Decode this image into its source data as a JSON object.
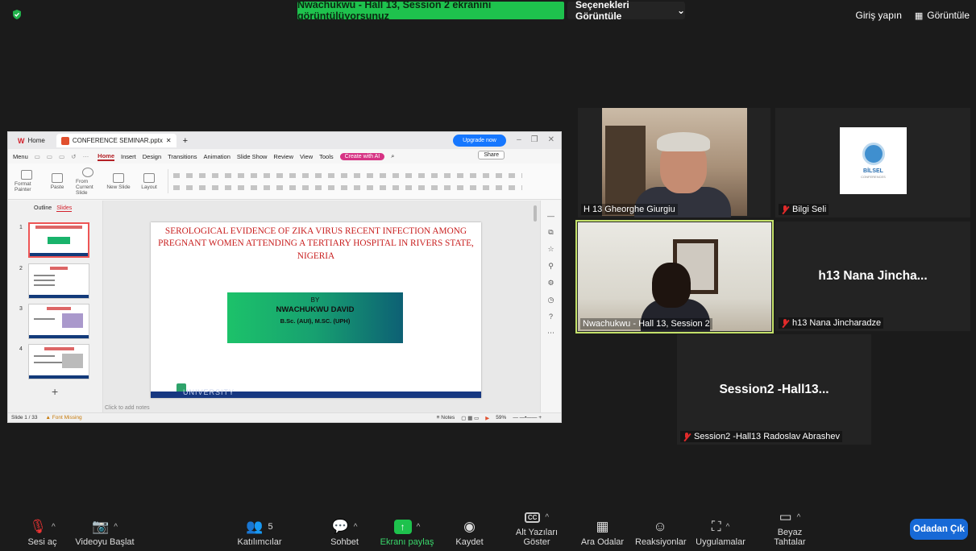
{
  "top": {
    "banner": "Nwachukwu - Hall 13, Session 2 ekranını görüntülüyorsunuz",
    "view_options": "Seçenekleri Görüntüle",
    "sign_in": "Giriş yapın",
    "view": "Görüntüle"
  },
  "shared_app": {
    "tab_home": "Home",
    "tab_file": "CONFERENCE SEMINAR.pptx",
    "upgrade": "Upgrade now",
    "menu": [
      "Menu",
      "Home",
      "Insert",
      "Design",
      "Transitions",
      "Animation",
      "Slide Show",
      "Review",
      "View",
      "Tools"
    ],
    "ai_button": "Create with AI",
    "share_button": "Share",
    "ribbon": [
      "Format Painter",
      "Paste",
      "From Current Slide",
      "New Slide",
      "Layout"
    ],
    "side_tabs": [
      "Outline",
      "Slides"
    ],
    "thumb_numbers": [
      "1",
      "2",
      "3",
      "4"
    ],
    "slide_title": "SEROLOGICAL EVIDENCE OF ZIKA VIRUS RECENT INFECTION AMONG PREGNANT WOMEN ATTENDING A TERTIARY HOSPITAL IN RIVERS STATE, NIGERIA",
    "slide_by": "BY",
    "slide_name": "NWACHUKWU DAVID",
    "slide_degree": "B.Sc. (AUI), M.SC. (UPH)",
    "slide_footer": "UNIVERSITY",
    "notes": "Click to add notes",
    "status_slide": "Slide 1 / 33",
    "status_font": "Font Missing",
    "status_notes": "Notes",
    "zoom": "59%"
  },
  "participants": {
    "p1": "H 13 Gheorghe Giurgiu",
    "p2": "Bilgi Seli",
    "p3": "Nwachukwu - Hall 13, Session 2",
    "p4_big": "h13  Nana  Jincha...",
    "p4": "h13 Nana Jincharadze",
    "p5_big": "Session2  -Hall13...",
    "p5": "Session2 -Hall13 Radoslav Abrashev",
    "logo_text": "BİLSEL",
    "logo_sub": "CONFERENCES"
  },
  "toolbar": {
    "audio": "Sesi aç",
    "video": "Videoyu Başlat",
    "participants": "Katılımcılar",
    "participants_count": "5",
    "chat": "Sohbet",
    "share": "Ekranı paylaş",
    "record": "Kaydet",
    "captions": "Alt Yazıları Göster",
    "breakout": "Ara Odalar",
    "reactions": "Reaksiyonlar",
    "apps": "Uygulamalar",
    "whiteboard": "Beyaz Tahtalar",
    "leave": "Odadan Çık"
  }
}
